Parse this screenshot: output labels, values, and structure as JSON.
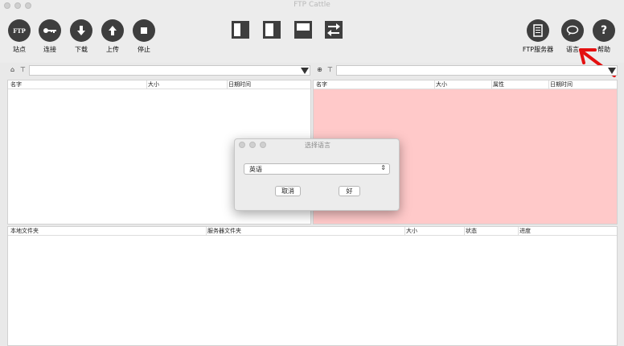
{
  "window": {
    "title": "FTP Cattle"
  },
  "toolbar": {
    "sites": {
      "icon_text": "FTP",
      "label": "站点"
    },
    "connect": {
      "label": "连接"
    },
    "download": {
      "label": "下载"
    },
    "upload": {
      "label": "上传"
    },
    "stop": {
      "label": "停止"
    },
    "ftp_server": {
      "label": "FTP服务器"
    },
    "language": {
      "label": "语言"
    },
    "help": {
      "icon_text": "?",
      "label": "帮助"
    }
  },
  "local_panel": {
    "columns": [
      "名字",
      "大小",
      "日期时间"
    ]
  },
  "remote_panel": {
    "columns": [
      "名字",
      "大小",
      "属性",
      "日期时间"
    ],
    "background_color": "#ffc9c9"
  },
  "queue_panel": {
    "columns": [
      "本地文件夹",
      "服务器文件夹",
      "大小",
      "状态",
      "进度"
    ]
  },
  "dialog": {
    "title": "选择语言",
    "select_value": "英语",
    "cancel_label": "取消",
    "ok_label": "好"
  },
  "annotation": {
    "arrow_color": "#e41010"
  }
}
